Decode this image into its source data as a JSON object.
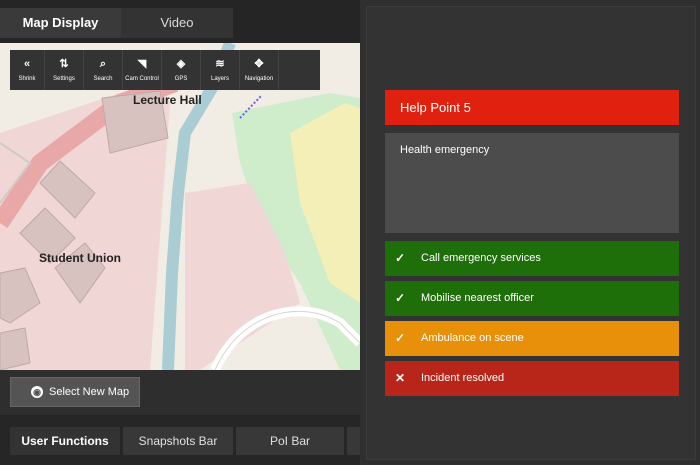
{
  "tabs": {
    "map_display": "Map Display",
    "video": "Video"
  },
  "toolbar": [
    {
      "icon": "double-chevron-left-icon",
      "glyph": "«",
      "label": "Shrink"
    },
    {
      "icon": "sliders-icon",
      "glyph": "⇅",
      "label": "Settings"
    },
    {
      "icon": "search-icon",
      "glyph": "⌕",
      "label": "Search"
    },
    {
      "icon": "cctv-camera-icon",
      "glyph": "◥",
      "label": "Cam Control"
    },
    {
      "icon": "crosshair-icon",
      "glyph": "◈",
      "label": "GPS"
    },
    {
      "icon": "layers-icon",
      "glyph": "≋",
      "label": "Layers"
    },
    {
      "icon": "move-arrows-icon",
      "glyph": "✥",
      "label": "Navigation"
    }
  ],
  "map": {
    "labels": {
      "lecture_hall": "Lecture Hall",
      "student_union": "Student Union"
    }
  },
  "select_map": {
    "label": "Select New Map"
  },
  "bottom_tabs": {
    "user_functions": "User Functions",
    "snapshots": "Snapshots Bar",
    "poi": "PoI Bar"
  },
  "incident": {
    "title": "Help Point 5",
    "description": "Health emergency",
    "steps": [
      {
        "mark": "✓",
        "label": "Call emergency services",
        "color": "#1e6e0a"
      },
      {
        "mark": "✓",
        "label": "Mobilise nearest officer",
        "color": "#1e6e0a"
      },
      {
        "mark": "✓",
        "label": "Ambulance on scene",
        "color": "#e8900a"
      },
      {
        "mark": "✕",
        "label": "Incident resolved",
        "color": "#b8261a"
      }
    ]
  }
}
